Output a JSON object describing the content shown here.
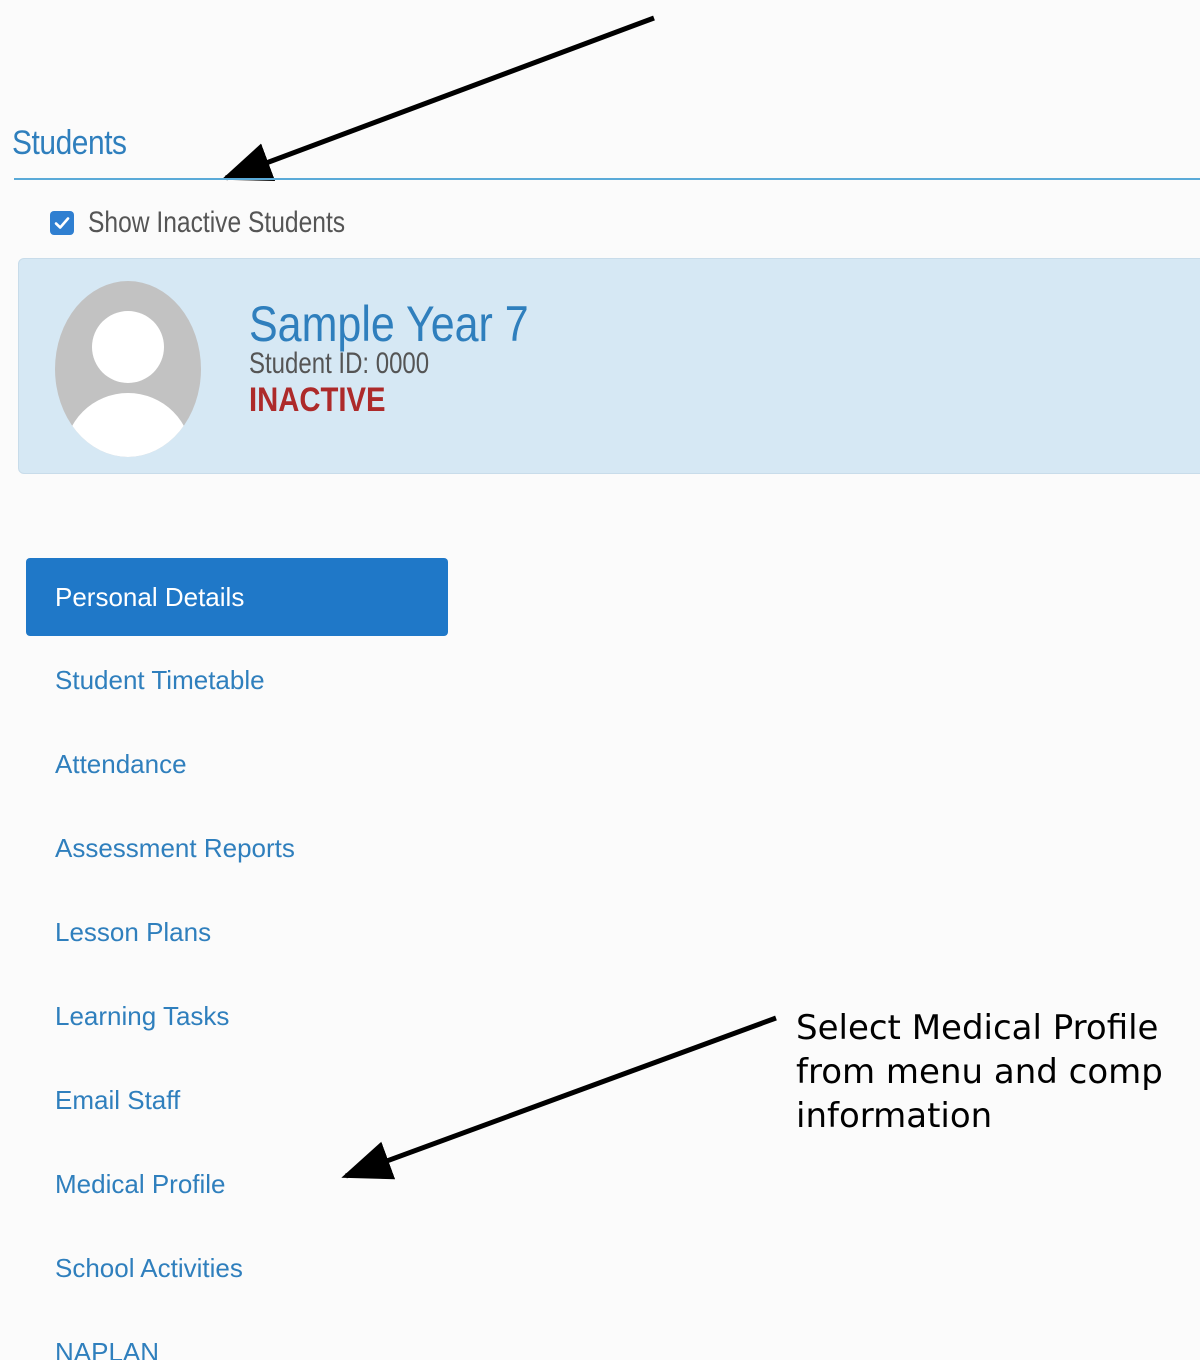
{
  "section": {
    "title": "Students"
  },
  "filter": {
    "show_inactive_label": "Show Inactive Students",
    "show_inactive_checked": true
  },
  "student": {
    "name": "Sample Year 7",
    "id_text": "Student ID: 0000",
    "status": "INACTIVE",
    "status_color": "#ad2a2a",
    "avatar_icon": "default-user-avatar"
  },
  "menu": {
    "active_index": 0,
    "items": [
      {
        "label": "Personal Details"
      },
      {
        "label": "Student Timetable"
      },
      {
        "label": "Attendance"
      },
      {
        "label": "Assessment Reports"
      },
      {
        "label": "Lesson Plans"
      },
      {
        "label": "Learning Tasks"
      },
      {
        "label": "Email Staff"
      },
      {
        "label": "Medical Profile"
      },
      {
        "label": "School Activities"
      },
      {
        "label": "NAPLAN"
      }
    ]
  },
  "annotation": {
    "lines": [
      "Select Medical Profile",
      "from menu and comp",
      "information"
    ]
  },
  "colors": {
    "accent": "#2f7fbd",
    "active_menu": "#1f78c8",
    "card_bg": "#d6e8f4"
  }
}
